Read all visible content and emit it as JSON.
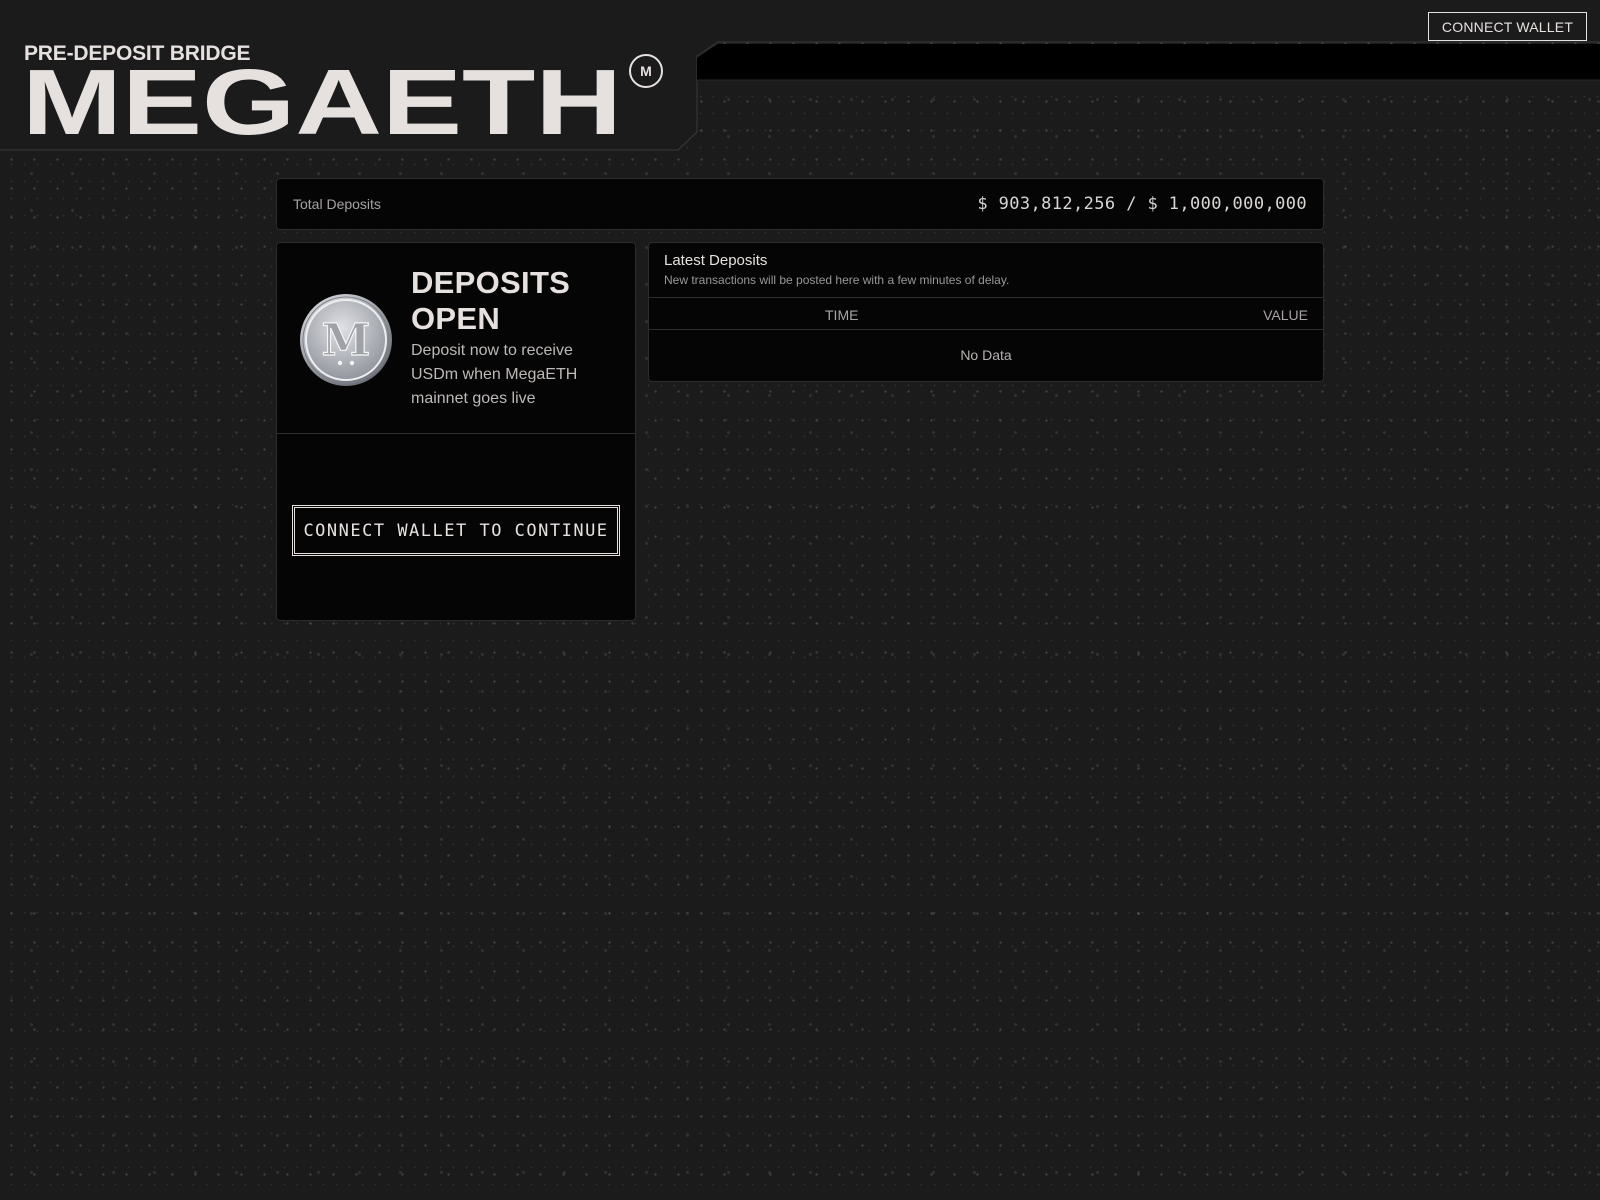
{
  "header": {
    "subtitle": "PRE-DEPOSIT BRIDGE",
    "logo_text": "MEGAETH",
    "badge_letter": "M",
    "connect_wallet_label": "CONNECT WALLET"
  },
  "totals": {
    "label": "Total Deposits",
    "value": "$ 903,812,256 / $ 1,000,000,000"
  },
  "deposit_card": {
    "title": "DEPOSITS OPEN",
    "description": "Deposit now to receive USDm when MegaETH mainnet goes live",
    "coin_letter": "M",
    "continue_label": "CONNECT WALLET TO CONTINUE"
  },
  "latest": {
    "title": "Latest Deposits",
    "subtitle": "New transactions will be posted here with a few minutes of delay.",
    "columns": {
      "time": "TIME",
      "value": "VALUE"
    },
    "empty_text": "No Data"
  },
  "colors": {
    "background": "#1b1b1c",
    "panel": "#050505",
    "text": "#e6e1df",
    "muted": "#a6a3a2"
  }
}
